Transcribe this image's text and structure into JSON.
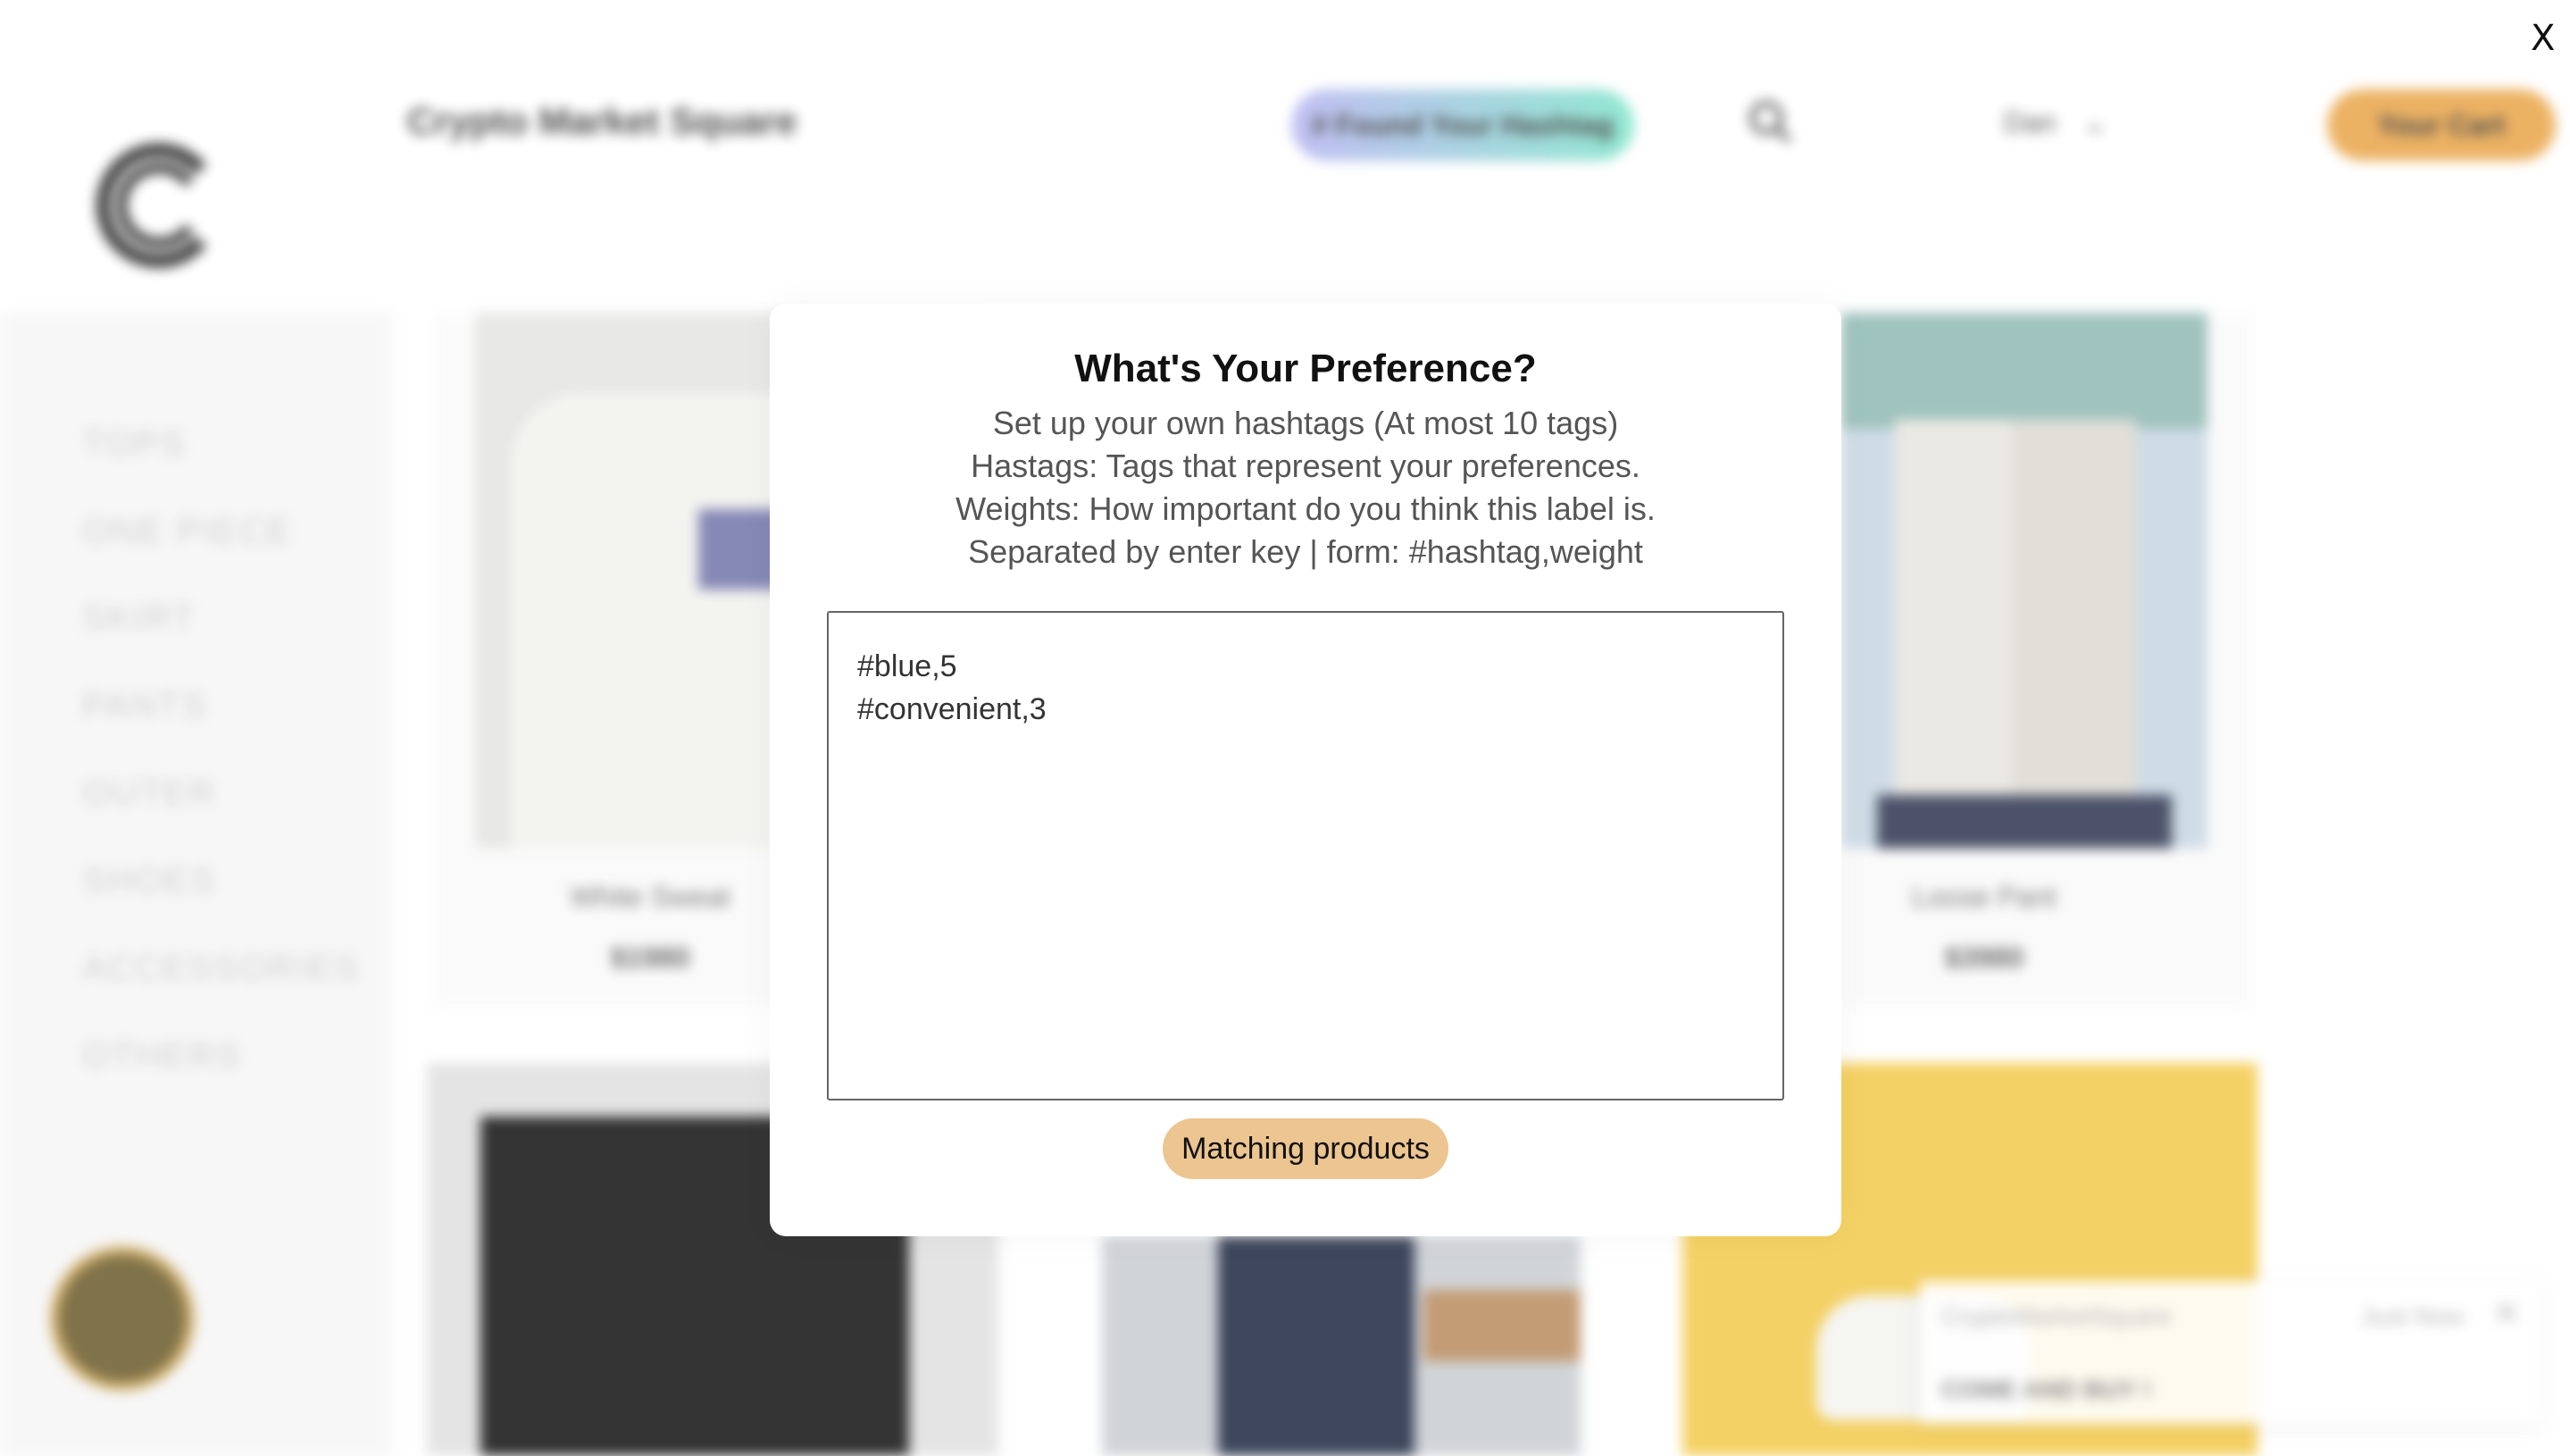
{
  "header": {
    "brand": "Crypto Market Square",
    "hashtag_button": "# Found Your Hashtag",
    "user_name": "Dan",
    "cart_button": "Your Cart"
  },
  "sidebar": {
    "items": [
      {
        "label": "TOPS"
      },
      {
        "label": "ONE PIECE"
      },
      {
        "label": "SKIRT"
      },
      {
        "label": "PANTS"
      },
      {
        "label": "OUTER"
      },
      {
        "label": "SHOES"
      },
      {
        "label": "ACCESSORIES"
      },
      {
        "label": "OTHERS"
      }
    ]
  },
  "products": [
    {
      "name": "White Sweat",
      "price": "$1980"
    },
    {
      "name": "Loose Pant",
      "price": "$3980"
    }
  ],
  "notification": {
    "app": "CryptoMarketSquare",
    "time": "Just Now",
    "message": "COME AND BUY !"
  },
  "modal": {
    "title": "What's Your Preference?",
    "lines": [
      "Set up your own hashtags (At most 10 tags)",
      "Hastags: Tags that represent your preferences.",
      "Weights: How important do you think this label is.",
      "Separated by enter key | form: #hashtag,weight"
    ],
    "input_value": "#blue,5\n#convenient,3",
    "button_label": "Matching products"
  },
  "close_label": "X",
  "colors": {
    "accent": "#ecc591",
    "cart": "#e9a548",
    "hashtag_gradient_start": "#b7b4f0",
    "hashtag_gradient_end": "#7fe3c9"
  }
}
